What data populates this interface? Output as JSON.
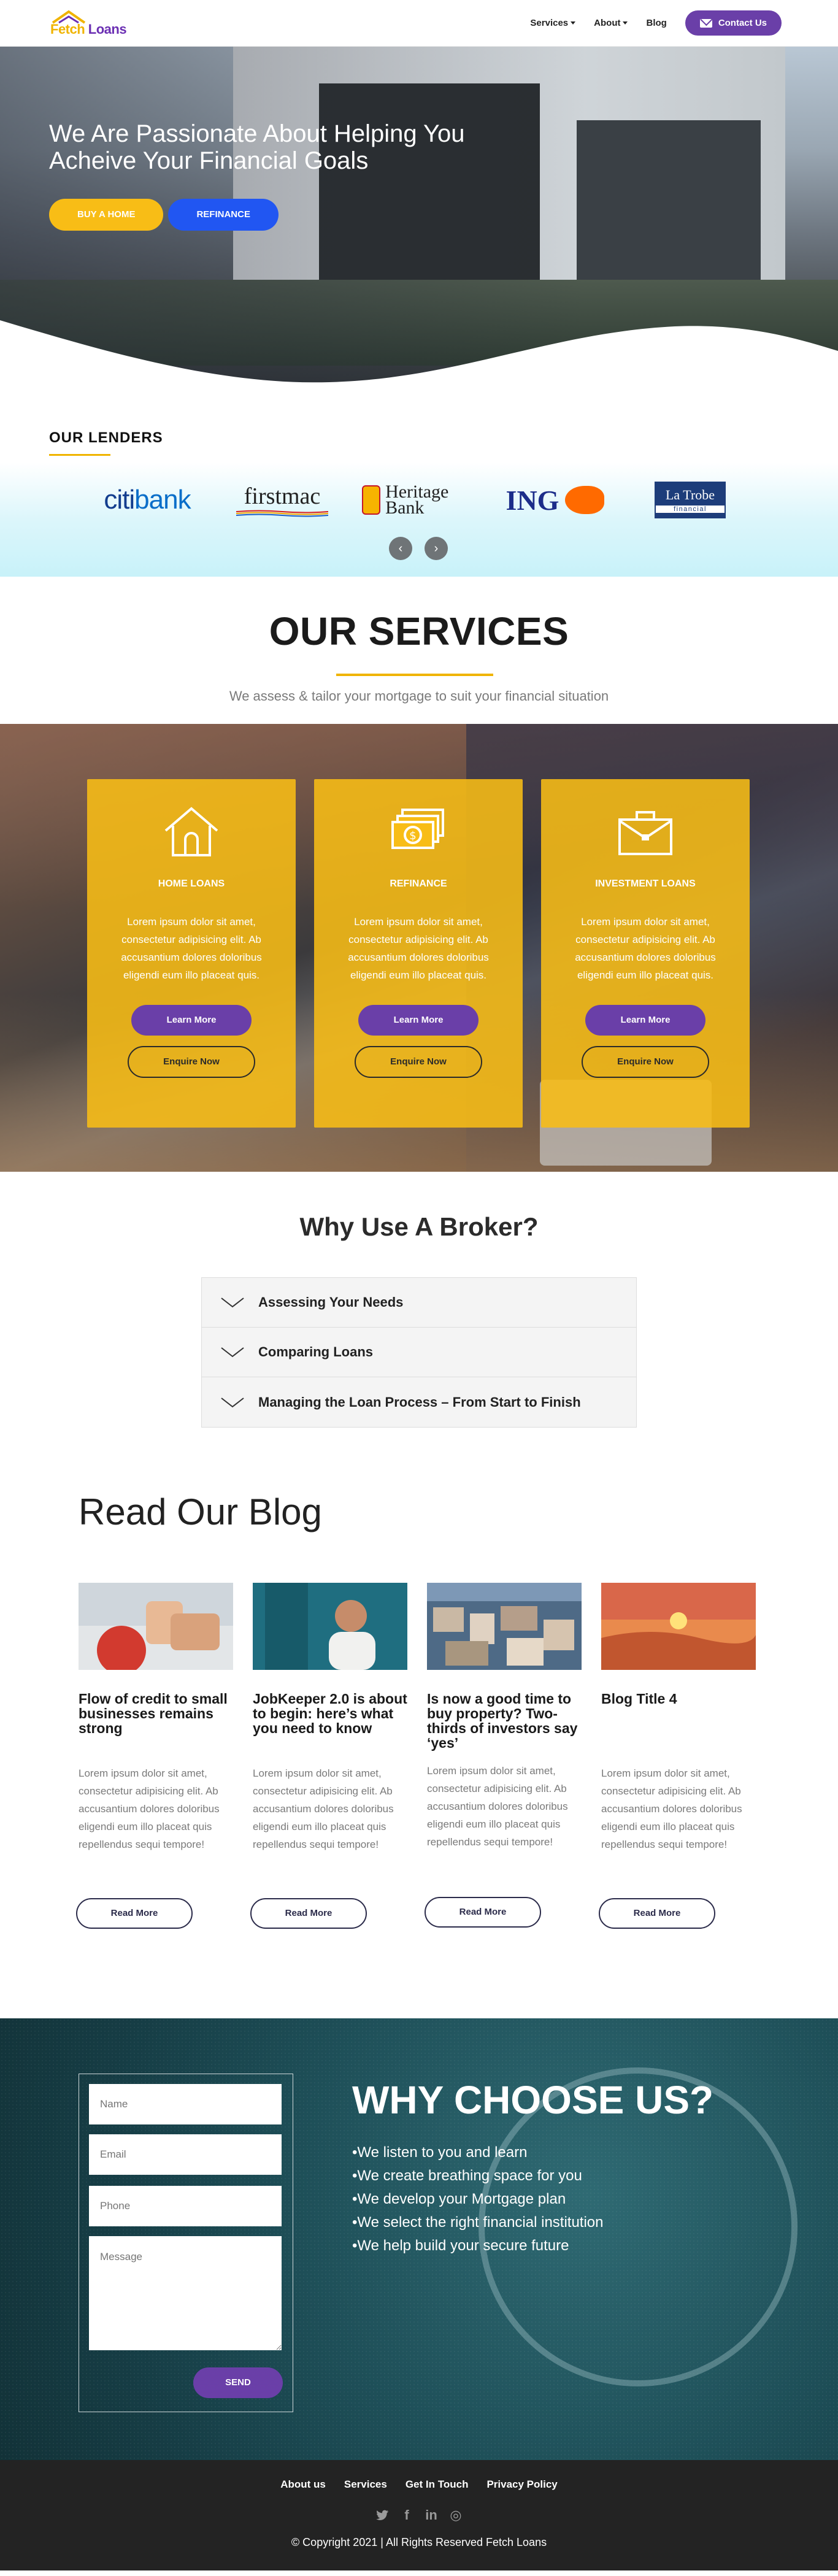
{
  "brand": {
    "logo_text_left": "Fetch",
    "logo_text_right": " Loans",
    "purple": "#6a3fa8",
    "yellow": "#f8bd16",
    "blue": "#2156f2"
  },
  "nav": {
    "items": [
      {
        "label": "Services",
        "has_caret": true
      },
      {
        "label": "About",
        "has_caret": true
      },
      {
        "label": "Blog",
        "has_caret": false
      }
    ],
    "contact_label": "Contact Us",
    "contact_icon": "mail-icon"
  },
  "hero": {
    "title": "We Are Passionate About Helping You Acheive Your Financial Goals",
    "buy_label": "BUY A HOME",
    "refinance_label": "REFINANCE"
  },
  "lenders": {
    "title": "OUR LENDERS",
    "citi_a": "citi",
    "citi_b": "bank",
    "firstmac": "firstmac",
    "heritage": "Heritage Bank",
    "ing": "ING",
    "latrobe_name": "La Trobe",
    "latrobe_sub": "financial",
    "prev_icon": "arrow-left-icon",
    "next_icon": "arrow-right-icon"
  },
  "services": {
    "title": "OUR SERVICES",
    "subtitle": "We assess & tailor your mortgage to suit your financial situation",
    "cards": [
      {
        "title": "HOME LOANS",
        "icon": "house-icon",
        "text": "Lorem ipsum dolor sit amet, consectetur adipisicing elit. Ab accusantium dolores doloribus eligendi eum illo placeat quis.",
        "learn": "Learn More",
        "enquire": "Enquire Now"
      },
      {
        "title": "REFINANCE",
        "icon": "money-icon",
        "text": "Lorem ipsum dolor sit amet, consectetur adipisicing elit. Ab accusantium dolores doloribus eligendi eum illo placeat quis.",
        "learn": "Learn More",
        "enquire": "Enquire Now"
      },
      {
        "title": "INVESTMENT LOANS",
        "icon": "briefcase-icon",
        "text": "Lorem ipsum dolor sit amet, consectetur adipisicing elit. Ab accusantium dolores doloribus eligendi eum illo placeat quis.",
        "learn": "Learn More",
        "enquire": "Enquire Now"
      }
    ]
  },
  "broker": {
    "title": "Why Use A Broker?",
    "items": [
      {
        "label": "Assessing Your Needs"
      },
      {
        "label": "Comparing Loans"
      },
      {
        "label": "Managing the Loan Process – From Start to Finish"
      }
    ]
  },
  "blog": {
    "title": "Read Our Blog",
    "posts": [
      {
        "title": "Flow of credit to small businesses remains strong",
        "text": "Lorem ipsum dolor sit amet, consectetur adipisicing elit. Ab accusantium dolores doloribus eligendi eum illo placeat quis repellendus sequi tempore!",
        "button": "Read More"
      },
      {
        "title": "JobKeeper 2.0 is about to begin: here’s what you need to know",
        "text": "Lorem ipsum dolor sit amet, consectetur adipisicing elit. Ab accusantium dolores doloribus eligendi eum illo placeat quis repellendus sequi tempore!",
        "button": "Read More"
      },
      {
        "title": "Is now a good time to buy property? Two-thirds of investors say ‘yes’",
        "text": "Lorem ipsum dolor sit amet, consectetur adipisicing elit. Ab accusantium dolores doloribus eligendi eum illo placeat quis repellendus sequi tempore!",
        "button": "Read More"
      },
      {
        "title": "Blog Title 4",
        "text": "Lorem ipsum dolor sit amet, consectetur adipisicing elit. Ab accusantium dolores doloribus eligendi eum illo placeat quis repellendus sequi tempore!",
        "button": "Read More"
      }
    ]
  },
  "why": {
    "title": "WHY CHOOSE US?",
    "points": [
      "•We listen to you and learn",
      "•We create breathing space for you",
      "•We develop your Mortgage plan",
      "•We select the right financial institution",
      "•We help build your secure future"
    ],
    "form": {
      "name_placeholder": "Name",
      "email_placeholder": "Email",
      "phone_placeholder": "Phone",
      "message_placeholder": "Message",
      "send_label": "SEND"
    }
  },
  "footer": {
    "links": [
      "About us",
      "Services",
      "Get In Touch",
      "Privacy Policy"
    ],
    "social": [
      {
        "icon": "twitter-icon",
        "glyph": "🐦"
      },
      {
        "icon": "facebook-icon",
        "glyph": "f"
      },
      {
        "icon": "linkedin-icon",
        "glyph": "in"
      },
      {
        "icon": "instagram-icon",
        "glyph": "◎"
      }
    ],
    "copyright": "© Copyright 2021 | All Rights Reserved Fetch Loans"
  }
}
